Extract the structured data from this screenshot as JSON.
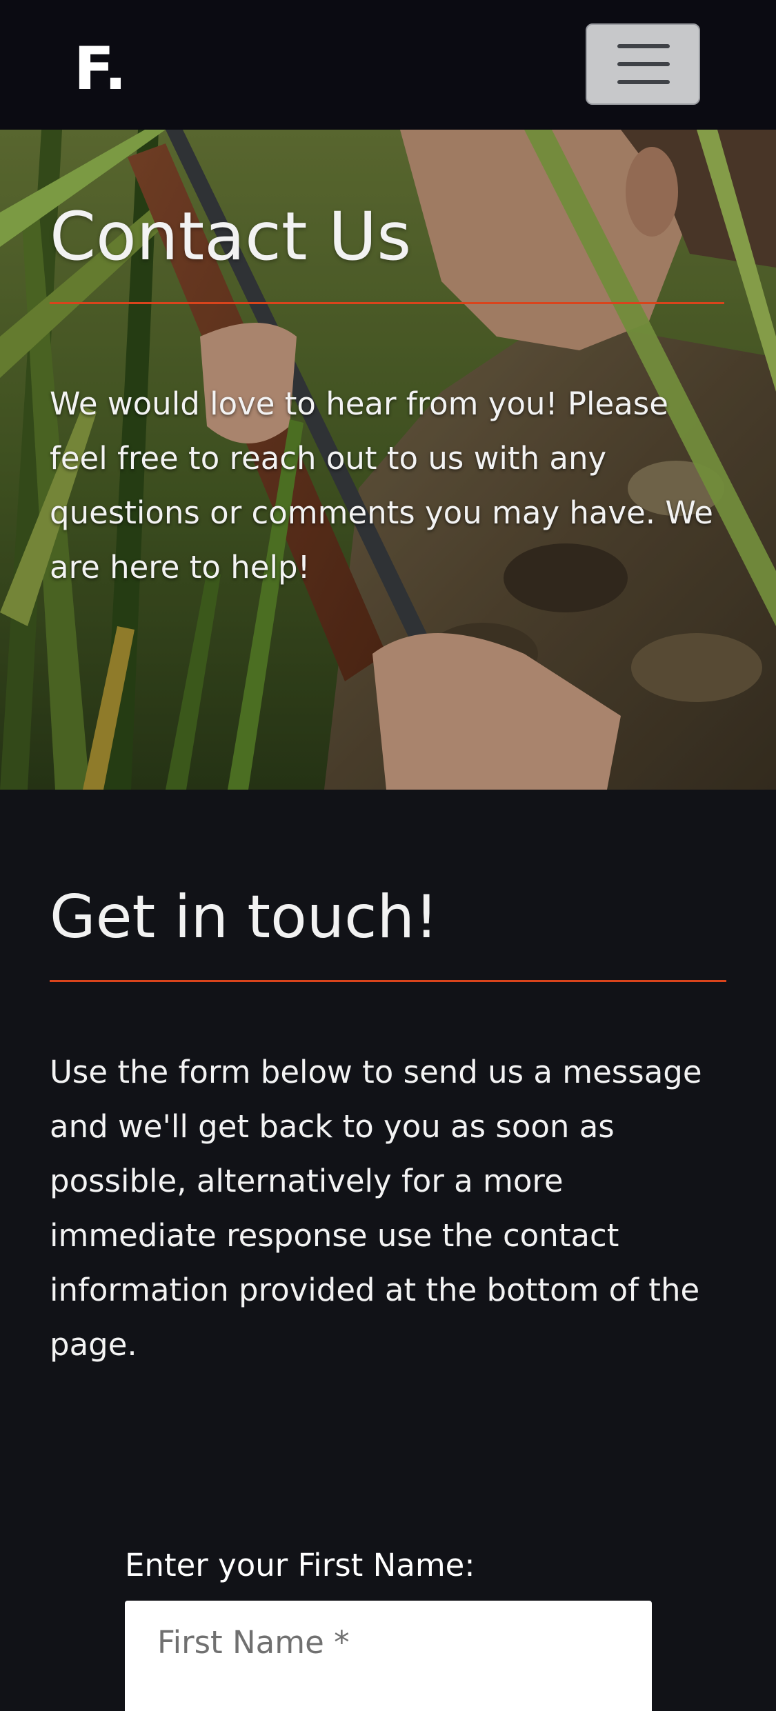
{
  "navbar": {
    "brand": "F."
  },
  "hero": {
    "title": "Contact Us",
    "text": "We would love to hear from you! Please feel free to reach out to us with any questions or comments you may have. We are here to help!",
    "background": "hunter-in-reeds-photo"
  },
  "touch": {
    "title": "Get in touch!",
    "text": "Use the form below to send us a message and we'll get back to you as soon as possible, alternatively for a more immediate response use the contact information provided at the bottom of the page."
  },
  "form": {
    "first_name_label": "Enter your First Name:",
    "first_name_placeholder": "First Name *",
    "first_name_value": ""
  },
  "colors": {
    "background": "#111217",
    "navbar": "#0b0b12",
    "accent": "#d9441c",
    "toggler": "#c7c8ca"
  }
}
